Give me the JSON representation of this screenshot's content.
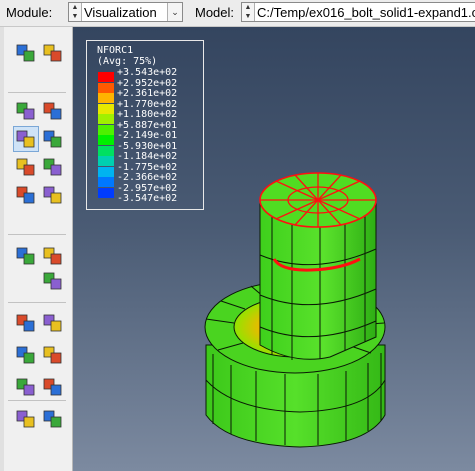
{
  "context_bar": {
    "module_label": "Module:",
    "module_value": "Visualization",
    "model_label": "Model:",
    "model_value": "C:/Temp/ex016_bolt_solid1-expand1.o"
  },
  "toolbox": {
    "icons": [
      "element-numbers-icon",
      "mesh-quality-icon",
      "undeformed-shape-icon",
      "deformed-shape-icon",
      "contour-plot-icon",
      "contour-options-icon",
      "symbol-plot-icon",
      "symbol-options-icon",
      "material-orientation-icon",
      "orientation-options-icon",
      "animate-scale-icon",
      "animate-time-icon",
      "animation-options-icon",
      "xy-data-icon",
      "xy-plot-options-icon",
      "path-icon",
      "xy-curve-icon",
      "display-group-icon",
      "display-group-options-icon",
      "query-icon",
      "report-icon"
    ],
    "selected": "contour-plot-icon"
  },
  "legend": {
    "title": "NFORC1",
    "subtitle": "(Avg: 75%)",
    "values": [
      "+3.543e+02",
      "+2.952e+02",
      "+2.361e+02",
      "+1.770e+02",
      "+1.180e+02",
      "+5.887e+01",
      "-2.149e-01",
      "-5.930e+01",
      "-1.184e+02",
      "-1.775e+02",
      "-2.366e+02",
      "-2.957e+02",
      "-3.547e+02"
    ],
    "colors": [
      "#ff0000",
      "#ff5a00",
      "#ffb400",
      "#e8e800",
      "#a0f000",
      "#4ef000",
      "#00f000",
      "#00e060",
      "#00d0b0",
      "#00b4f0",
      "#0078ff",
      "#003cff",
      "#0000ff"
    ]
  },
  "model": {
    "body_color": "#46d21e",
    "edge_color": "#0a1a05",
    "highlight_color": "#ff1010"
  }
}
